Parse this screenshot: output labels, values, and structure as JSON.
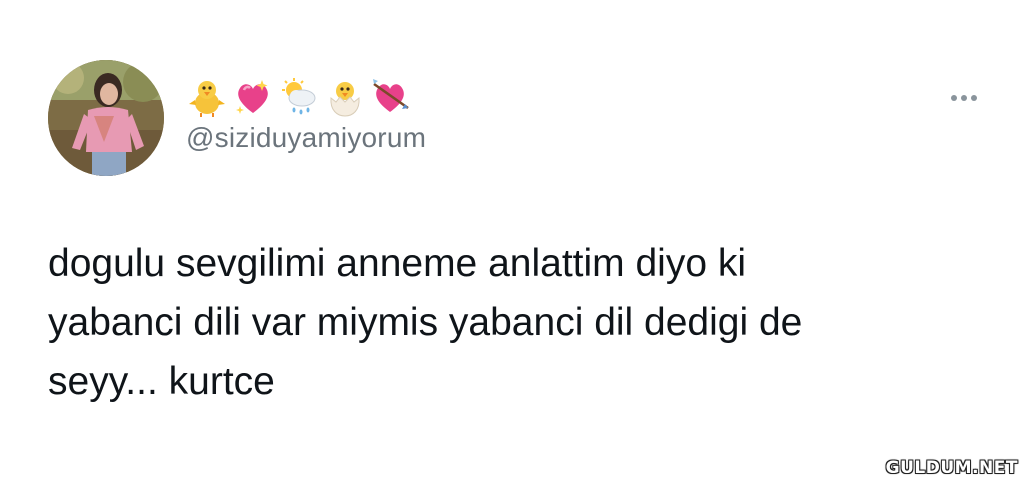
{
  "author": {
    "display_name_icons": [
      "baby-chick-icon",
      "sparkling-heart-icon",
      "sun-behind-rain-cloud-icon",
      "hatching-chick-icon",
      "heart-with-arrow-icon"
    ],
    "handle": "@siziduyamiyorum",
    "avatar": "profile-photo"
  },
  "tweet": {
    "lines": [
      "dogulu sevgilimi anneme anlattim diyo ki",
      "yabanci dili var miymis yabanci dil dedigi de",
      "seyy... kurtce"
    ]
  },
  "menu": {
    "icon": "more-icon"
  },
  "watermark": {
    "text": "GULDUM.NET"
  },
  "colors": {
    "background": "#ffffff",
    "text": "#0f1419",
    "secondary_text": "#6b747c",
    "heart_pink": "#e8418a"
  }
}
